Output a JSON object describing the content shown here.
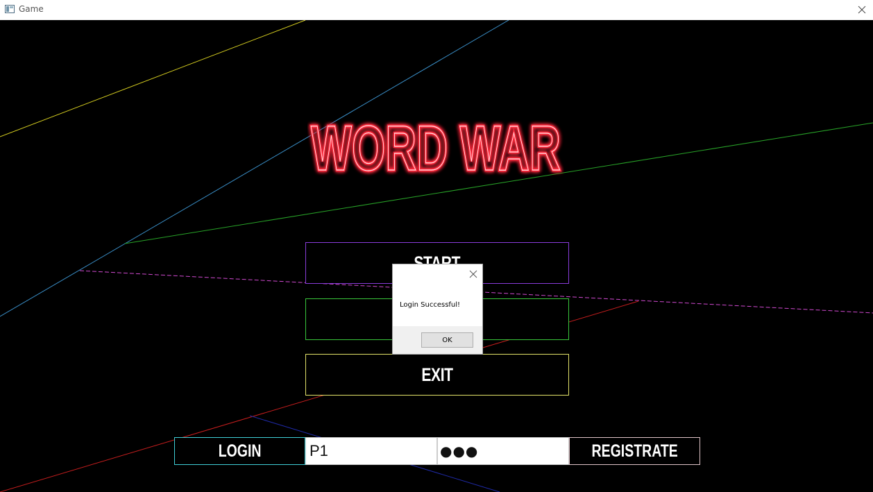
{
  "window": {
    "title": "Game",
    "close_icon": "close-icon",
    "app_icon": "app-icon"
  },
  "game": {
    "logo_text": "WORD WAR",
    "menu": {
      "start": "START",
      "second": "",
      "exit": "EXIT"
    },
    "login_bar": {
      "login_label": "LOGIN",
      "username_value": "P1",
      "password_value": "●●●",
      "register_label": "REGISTRATE"
    }
  },
  "dialog": {
    "message": "Login Successful!",
    "ok_label": "OK"
  },
  "colors": {
    "background": "#000000",
    "logo": "#ff2a3c",
    "start_border": "#8a3ddc",
    "second_border": "#39c83c",
    "exit_border": "#e3e36a",
    "login_border": "#3fd0d8",
    "register_border": "#e0c4c8"
  }
}
